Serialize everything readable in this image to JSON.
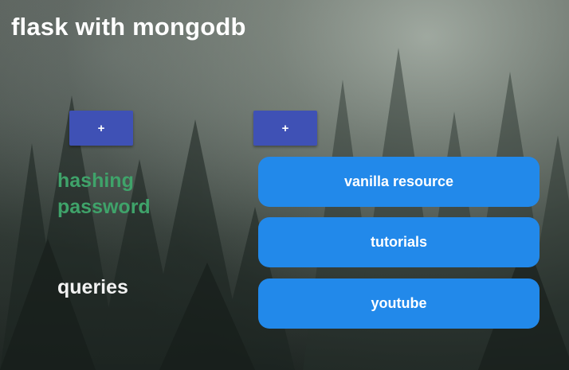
{
  "page": {
    "title": "flask with mongodb"
  },
  "controls": {
    "add_left_label": "+",
    "add_right_label": "+"
  },
  "topics": [
    {
      "label": "hashing password",
      "color": "#3fa36a"
    },
    {
      "label": "queries",
      "color": "#f2f2f2"
    }
  ],
  "links": [
    {
      "label": "vanilla resource"
    },
    {
      "label": "tutorials"
    },
    {
      "label": "youtube"
    }
  ],
  "colors": {
    "add_button": "#3f51b5",
    "link_button": "#2289ea"
  },
  "background": {
    "description_icon": "foggy-forest-background"
  }
}
